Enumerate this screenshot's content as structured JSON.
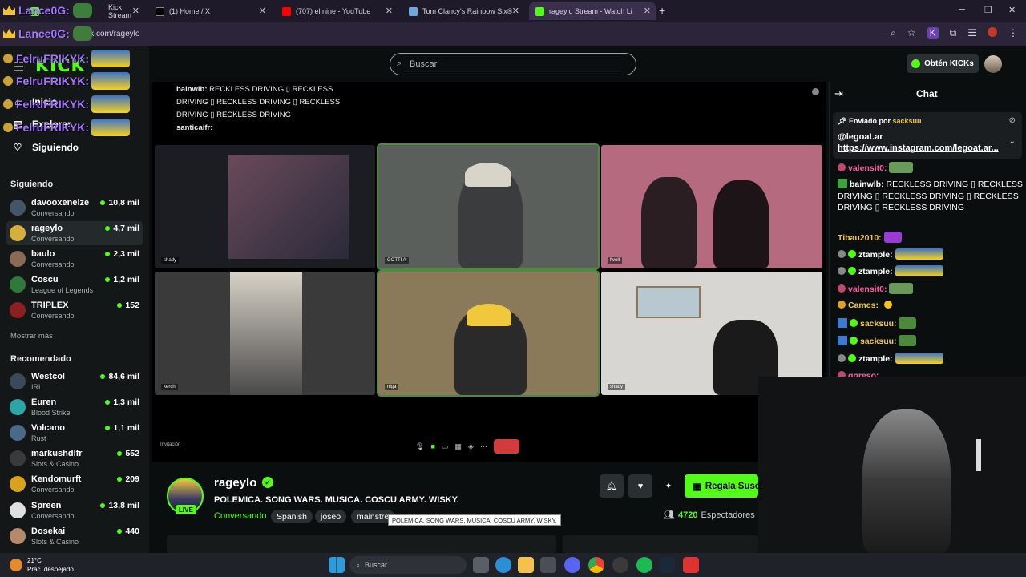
{
  "browser": {
    "tabs": [
      {
        "label": "Kick Stream",
        "color": "#53fc18"
      },
      {
        "label": "(1) Home / X",
        "color": "#000000"
      },
      {
        "label": "(707) el nine - YouTube",
        "color": "#ff0000"
      },
      {
        "label": "Tom Clancy's Rainbow Six® Sie...",
        "color": "#1b2838"
      },
      {
        "label": "rageylo Stream - Watch Live...",
        "color": "#53fc18"
      }
    ],
    "url": "kick.com/rageylo"
  },
  "overlay": {
    "user1": "Lance0G:",
    "user2": "FelruFRIKYK:"
  },
  "header": {
    "search_placeholder": "Buscar",
    "kicks_label": "Obtén KICKs"
  },
  "sidebar": {
    "logo": "KICK",
    "nav": [
      "Inicio",
      "Explorar",
      "Siguiendo"
    ],
    "following_title": "Siguiendo",
    "following": [
      {
        "name": "davooxeneize",
        "category": "Conversando",
        "viewers": "10,8 mil",
        "color": "#445566"
      },
      {
        "name": "rageylo",
        "category": "Conversando",
        "viewers": "4,7 mil",
        "color": "#d6b13a"
      },
      {
        "name": "baulo",
        "category": "Conversando",
        "viewers": "2,3 mil",
        "color": "#8a6a55"
      },
      {
        "name": "Coscu",
        "category": "League of Legends",
        "viewers": "1,2 mil",
        "color": "#2f7a3a"
      },
      {
        "name": "TRIPLEX",
        "category": "Conversando",
        "viewers": "152",
        "color": "#8c1f1f"
      }
    ],
    "show_more": "Mostrar más",
    "recommended_title": "Recomendado",
    "recommended": [
      {
        "name": "Westcol",
        "category": "IRL",
        "viewers": "84,6 mil",
        "color": "#3a4a5a"
      },
      {
        "name": "Euren",
        "category": "Blood Strike",
        "viewers": "1,3 mil",
        "color": "#2aa6a6"
      },
      {
        "name": "Volcano",
        "category": "Rust",
        "viewers": "1,1 mil",
        "color": "#4a6a8a"
      },
      {
        "name": "markushdlfr",
        "category": "Slots & Casino",
        "viewers": "552",
        "color": "#3a3a3a"
      },
      {
        "name": "Kendomurft",
        "category": "Conversando",
        "viewers": "209",
        "color": "#d9a21c"
      },
      {
        "name": "Spreen",
        "category": "Conversando",
        "viewers": "13,8 mil",
        "color": "#e0e0e0"
      },
      {
        "name": "Dosekai",
        "category": "Slots & Casino",
        "viewers": "440",
        "color": "#b58a6a"
      }
    ]
  },
  "video": {
    "chat_lines": [
      {
        "user": "bainwlb:",
        "text": "RECKLESS DRIVING ▯ RECKLESS DRIVING ▯ RECKLESS DRIVING ▯ RECKLESS DRIVING ▯ RECKLESS DRIVING"
      },
      {
        "user": "santicaifr:",
        "text": ""
      }
    ],
    "participants": [
      "shady",
      "GOTTI A",
      "fwell",
      "kerch",
      "niga",
      "shady"
    ],
    "invite_label": "Invitación"
  },
  "channel": {
    "name": "rageylo",
    "live_label": "LIVE",
    "title": "POLEMICA. SONG WARS. MUSICA. COSCU ARMY. WISKY.",
    "category": "Conversando",
    "tags": [
      "Spanish",
      "joseo",
      "mainstre"
    ],
    "tooltip": "POLEMICA. SONG WARS. MUSICA. COSCU ARMY. WISKY.",
    "gift_label": "Regala Susc",
    "viewers_count": "4720",
    "viewers_label": "Espectadores"
  },
  "chat": {
    "title": "Chat",
    "pinned_by_label": "Enviado por",
    "pinned_by_user": "sacksuu",
    "pinned_line1": "@legoat.ar",
    "pinned_line2": "https://www.instagram.com/legoat.ar...",
    "messages": [
      {
        "user": "valensit0:",
        "text": "",
        "color": "#ff5f9e",
        "badge": "#c0496d"
      },
      {
        "user": "bainwlb:",
        "text": "RECKLESS DRIVING ▯ RECKLESS DRIVING ▯ RECKLESS DRIVING ▯ RECKLESS DRIVING ▯ RECKLESS DRIVING",
        "color": "#ffffff",
        "badge": "#3aa53a"
      },
      {
        "user": "Tibau2010:",
        "text": "",
        "color": "#f0c83c",
        "badge": ""
      },
      {
        "user": "ztample:",
        "text": "",
        "color": "#ffffff",
        "badge": "#888888"
      },
      {
        "user": "ztample:",
        "text": "",
        "color": "#ffffff",
        "badge": "#888888"
      },
      {
        "user": "valensit0:",
        "text": "",
        "color": "#ff5f9e",
        "badge": "#c0496d"
      },
      {
        "user": "Camcs:",
        "text": "",
        "color": "#f0c83c",
        "badge": "#e0a020"
      },
      {
        "user": "sacksuu:",
        "text": "",
        "color": "#f0c83c",
        "badge": "#3a7bd5"
      },
      {
        "user": "sacksuu:",
        "text": "",
        "color": "#f0c83c",
        "badge": "#3a7bd5"
      },
      {
        "user": "ztample:",
        "text": "",
        "color": "#ffffff",
        "badge": "#888888"
      },
      {
        "user": "gnreso:",
        "text": "",
        "color": "#ff5f9e",
        "badge": "#c0496d"
      }
    ]
  },
  "taskbar": {
    "temp": "21°C",
    "weather": "Prac. despejado",
    "search_label": "Buscar"
  }
}
